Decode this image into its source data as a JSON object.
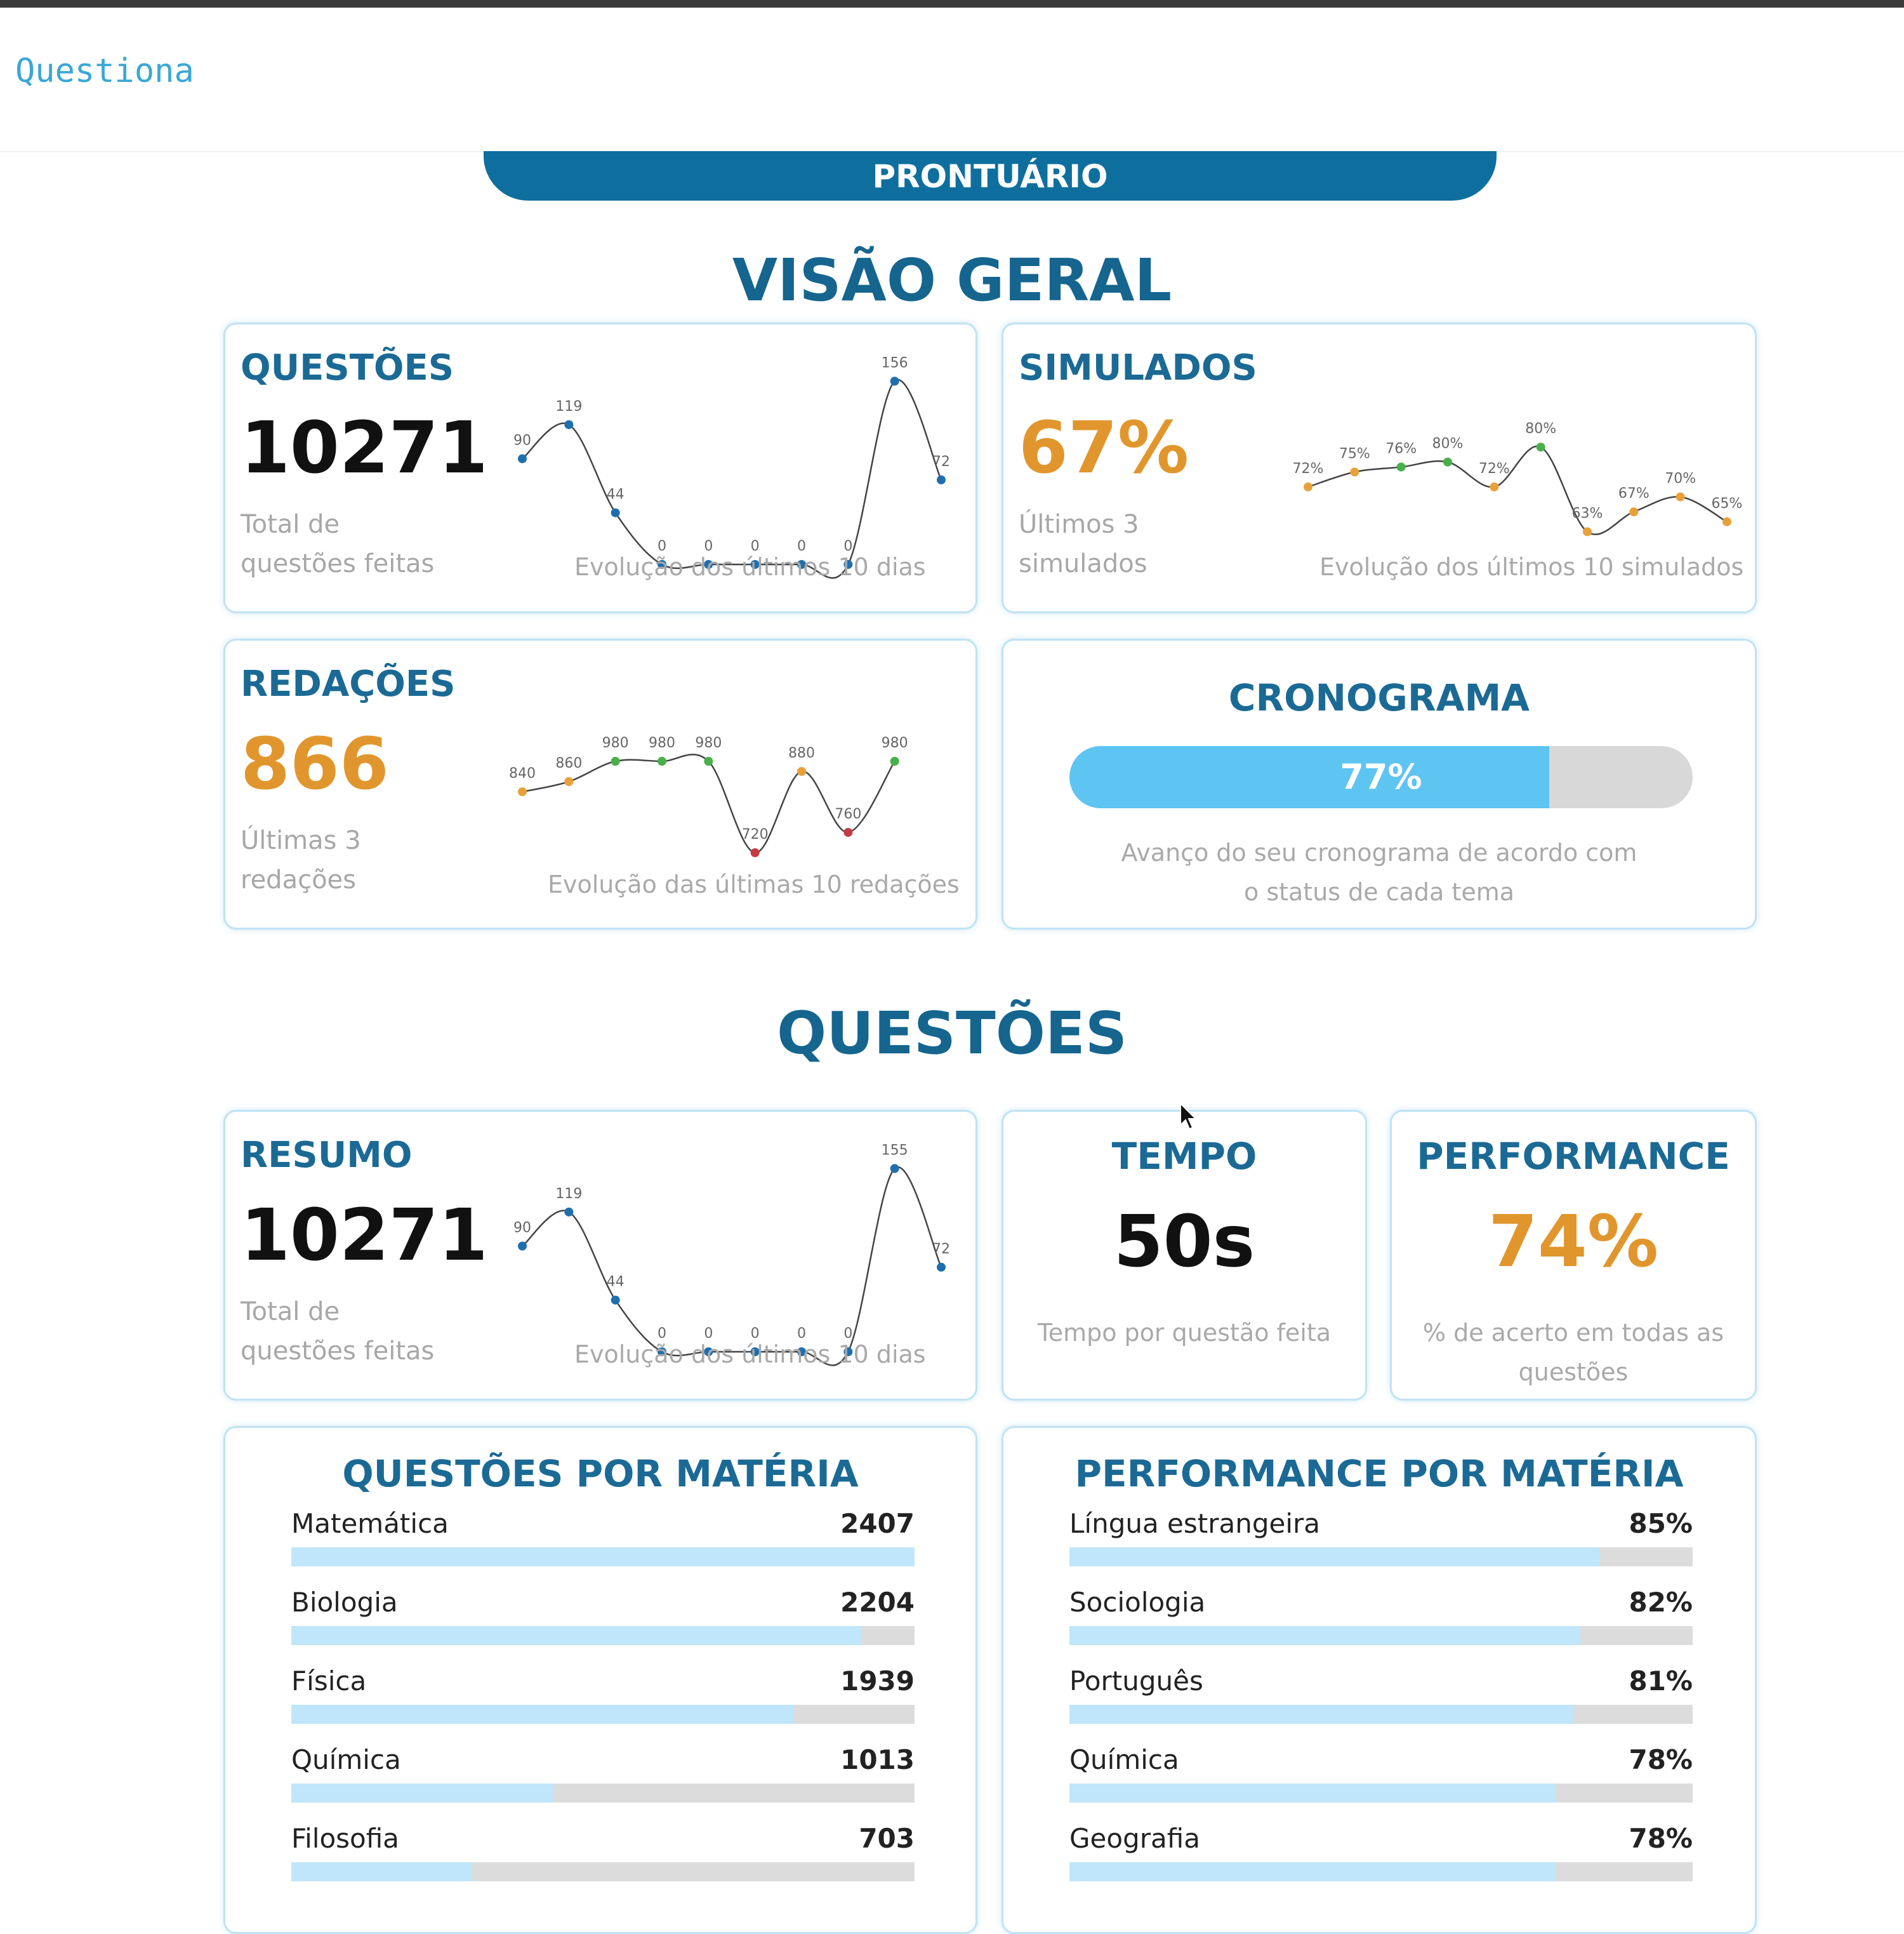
{
  "app": {
    "brand": "Questiona"
  },
  "banner": {
    "label": "PRONTUÁRIO"
  },
  "sections": {
    "overview_title": "VISÃO GERAL",
    "questions_title": "QUESTÕES"
  },
  "colors": {
    "primary": "#15658f",
    "accent": "#e1962d",
    "progress": "#5ec4f2",
    "point_blue": "#1f6fae",
    "point_orange": "#e8a13a",
    "point_green": "#48b04a",
    "point_red": "#c53a44"
  },
  "cards": {
    "questoes": {
      "title": "QUESTÕES",
      "value": "10271",
      "sub_line1": "Total de",
      "sub_line2": "questões feitas",
      "caption": "Evolução dos últimos 10 dias"
    },
    "simulados": {
      "title": "SIMULADOS",
      "value": "67%",
      "sub_line1": "Últimos 3",
      "sub_line2": "simulados",
      "caption": "Evolução dos últimos 10 simulados"
    },
    "redacoes": {
      "title": "REDAÇÕES",
      "value": "866",
      "sub_line1": "Últimas 3",
      "sub_line2": "redações",
      "caption": "Evolução das últimas 10 redações"
    },
    "cronograma": {
      "title": "CRONOGRAMA",
      "progress_label": "77%",
      "progress_value": 0.77,
      "sub_line1": "Avanço do seu cronograma de acordo com",
      "sub_line2": "o status de cada tema"
    },
    "resumo": {
      "title": "RESUMO",
      "value": "10271",
      "sub_line1": "Total de",
      "sub_line2": "questões feitas",
      "caption": "Evolução dos últimos 10 dias"
    },
    "tempo": {
      "title": "TEMPO",
      "value": "50s",
      "sub_line1": "Tempo por questão feita"
    },
    "performance": {
      "title": "PERFORMANCE",
      "value": "74%",
      "sub_line1": "% de acerto em todas as",
      "sub_line2": "questões"
    },
    "questoes_materia": {
      "title": "QUESTÕES POR MATÉRIA",
      "items": [
        {
          "name": "Matemática",
          "value": "2407",
          "fraction": 1.0
        },
        {
          "name": "Biologia",
          "value": "2204",
          "fraction": 0.915
        },
        {
          "name": "Física",
          "value": "1939",
          "fraction": 0.805
        },
        {
          "name": "Química",
          "value": "1013",
          "fraction": 0.42
        },
        {
          "name": "Filosofia",
          "value": "703",
          "fraction": 0.29
        }
      ]
    },
    "performance_materia": {
      "title": "PERFORMANCE POR MATÉRIA",
      "items": [
        {
          "name": "Língua estrangeira",
          "value": "85%",
          "fraction": 0.85
        },
        {
          "name": "Sociologia",
          "value": "82%",
          "fraction": 0.82
        },
        {
          "name": "Português",
          "value": "81%",
          "fraction": 0.81
        },
        {
          "name": "Química",
          "value": "78%",
          "fraction": 0.78
        },
        {
          "name": "Geografia",
          "value": "78%",
          "fraction": 0.78
        }
      ]
    }
  },
  "chart_data": [
    {
      "id": "questoes-sparkline",
      "type": "line",
      "x": [
        1,
        2,
        3,
        4,
        5,
        6,
        7,
        8,
        9,
        10
      ],
      "values": [
        90,
        119,
        44,
        0,
        0,
        0,
        0,
        0,
        156,
        72
      ],
      "labels": [
        "90",
        "119",
        "44",
        "0",
        "0",
        "0",
        "0",
        "0",
        "156",
        "72"
      ],
      "point_colors": [
        "blue",
        "blue",
        "blue",
        "blue",
        "blue",
        "blue",
        "blue",
        "blue",
        "blue",
        "blue"
      ],
      "ylim": [
        0,
        160
      ],
      "grid": false
    },
    {
      "id": "simulados-sparkline",
      "type": "line",
      "x": [
        1,
        2,
        3,
        4,
        5,
        6,
        7,
        8,
        9,
        10
      ],
      "values": [
        72,
        75,
        76,
        77,
        72,
        80,
        63,
        67,
        70,
        65
      ],
      "labels": [
        "72%",
        "75%",
        "76%",
        "80%",
        "72%",
        "80%",
        "63%",
        "67%",
        "70%",
        "65%"
      ],
      "point_colors": [
        "orange",
        "orange",
        "green",
        "green",
        "orange",
        "green",
        "orange",
        "orange",
        "orange",
        "orange"
      ],
      "ylim": [
        60,
        85
      ],
      "grid": false
    },
    {
      "id": "redacoes-sparkline",
      "type": "line",
      "x": [
        1,
        2,
        3,
        4,
        5,
        6,
        7,
        8,
        9,
        10
      ],
      "values": [
        840,
        860,
        900,
        900,
        900,
        720,
        880,
        760,
        900
      ],
      "labels": [
        "840",
        "860",
        "980",
        "980",
        "980",
        "720",
        "880",
        "760",
        "980"
      ],
      "point_colors": [
        "orange",
        "orange",
        "green",
        "green",
        "green",
        "red",
        "orange",
        "red",
        "green"
      ],
      "ylim": [
        700,
        920
      ],
      "grid": false
    },
    {
      "id": "resumo-sparkline",
      "type": "line",
      "x": [
        1,
        2,
        3,
        4,
        5,
        6,
        7,
        8,
        9,
        10
      ],
      "values": [
        90,
        119,
        44,
        0,
        0,
        0,
        0,
        0,
        156,
        72
      ],
      "labels": [
        "90",
        "119",
        "44",
        "0",
        "0",
        "0",
        "0",
        "0",
        "155",
        "72"
      ],
      "point_colors": [
        "blue",
        "blue",
        "blue",
        "blue",
        "blue",
        "blue",
        "blue",
        "blue",
        "blue",
        "blue"
      ],
      "ylim": [
        0,
        160
      ],
      "grid": false
    }
  ]
}
